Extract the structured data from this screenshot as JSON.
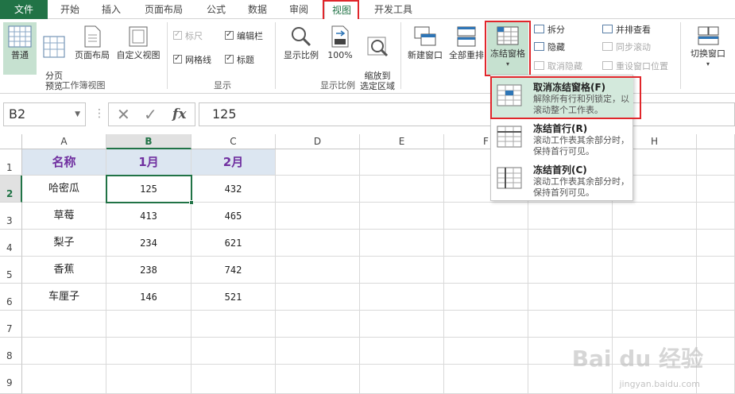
{
  "ribbon_tabs": [
    "文件",
    "开始",
    "插入",
    "页面布局",
    "公式",
    "数据",
    "审阅",
    "视图",
    "开发工具"
  ],
  "ribbon": {
    "workbook_views": {
      "normal": "普通",
      "page_break": "分页\n预览",
      "page_layout": "页面布局",
      "custom_view": "自定义视图",
      "group_label": "工作簿视图"
    },
    "show": {
      "ruler": "标尺",
      "formula_bar": "编辑栏",
      "gridlines": "网格线",
      "headings": "标题",
      "group_label": "显示"
    },
    "zoom": {
      "zoom": "显示比例",
      "hundred": "100%",
      "zoom_selection": "缩放到\n选定区域",
      "group_label": "显示比例"
    },
    "window": {
      "new_window": "新建窗口",
      "arrange_all": "全部重排",
      "freeze_panes": "冻结窗格",
      "split": "拆分",
      "hide": "隐藏",
      "unhide": "取消隐藏",
      "side_by_side": "并排查看",
      "sync_scroll": "同步滚动",
      "reset_position": "重设窗口位置",
      "switch_windows": "切换窗口"
    }
  },
  "formula_bar": {
    "name_box": "B2",
    "cancel_icon": "✕",
    "enter_icon": "✓",
    "fx": "fx",
    "value": "125"
  },
  "columns": [
    "A",
    "B",
    "C",
    "D",
    "E",
    "F",
    "G",
    "H"
  ],
  "rows": [
    "1",
    "2",
    "3",
    "4",
    "5",
    "6",
    "7",
    "8",
    "9"
  ],
  "table": {
    "headers": [
      "名称",
      "1月",
      "2月"
    ],
    "rows": [
      [
        "哈密瓜",
        "125",
        "432"
      ],
      [
        "草莓",
        "413",
        "465"
      ],
      [
        "梨子",
        "234",
        "621"
      ],
      [
        "香蕉",
        "238",
        "742"
      ],
      [
        "车厘子",
        "146",
        "521"
      ]
    ]
  },
  "freeze_menu": [
    {
      "title": "取消冻结窗格(F)",
      "desc": "解除所有行和列锁定，以滚动整个工作表。"
    },
    {
      "title": "冻结首行(R)",
      "desc": "滚动工作表其余部分时，保持首行可见。"
    },
    {
      "title": "冻结首列(C)",
      "desc": "滚动工作表其余部分时，保持首列可见。"
    }
  ],
  "watermark": {
    "main": "Bai du 经验",
    "sub": "jingyan.baidu.com"
  },
  "colors": {
    "excel_green": "#217346",
    "highlight_red": "#e0262b",
    "header_fill": "#dce6f1",
    "header_text": "#7030a0"
  }
}
